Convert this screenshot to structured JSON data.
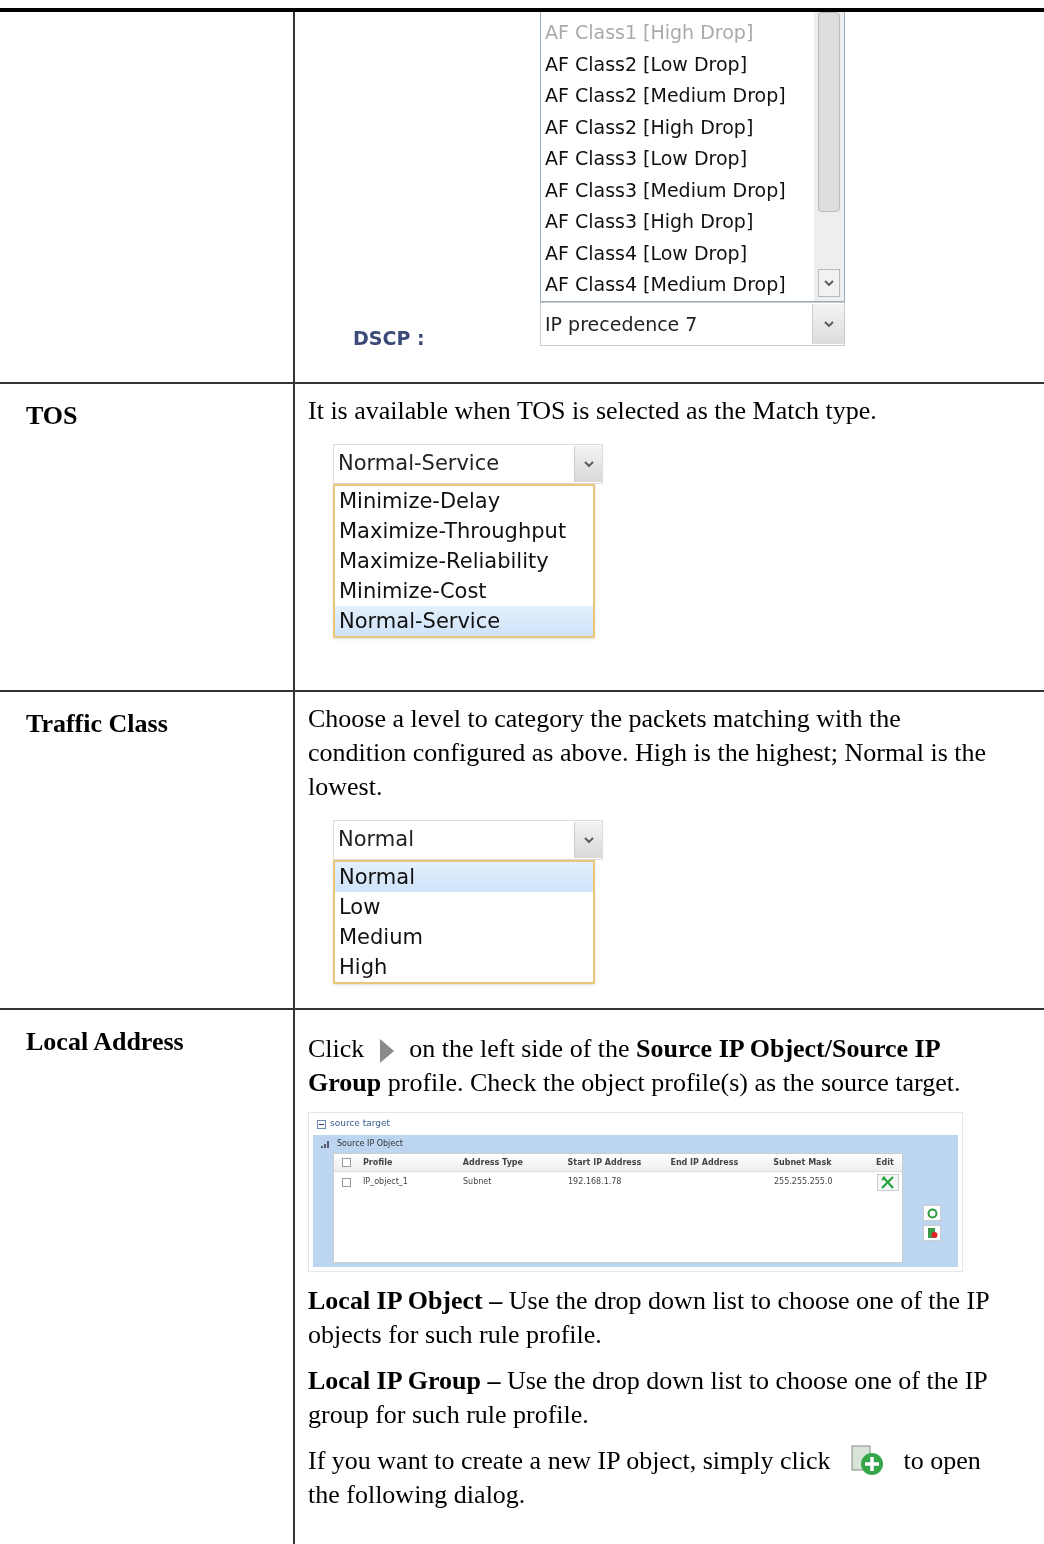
{
  "dscp_row": {
    "list_items": [
      {
        "label": "AF Class1 [High Drop]",
        "faded": true
      },
      {
        "label": "AF Class2 [Low Drop]",
        "faded": false
      },
      {
        "label": "AF Class2 [Medium Drop]",
        "faded": false
      },
      {
        "label": "AF Class2 [High Drop]",
        "faded": false
      },
      {
        "label": "AF Class3 [Low Drop]",
        "faded": false
      },
      {
        "label": "AF Class3 [Medium Drop]",
        "faded": false
      },
      {
        "label": "AF Class3 [High Drop]",
        "faded": false
      },
      {
        "label": "AF Class4 [Low Drop]",
        "faded": false
      },
      {
        "label": "AF Class4 [Medium Drop]",
        "faded": false
      }
    ],
    "label": "DSCP :",
    "value": "IP precedence 7"
  },
  "rows": [
    {
      "kind": "dropdown",
      "label": "TOS",
      "description": "It is available when TOS is selected as the Match type.",
      "dropdown": {
        "value": "Normal-Service",
        "options": [
          {
            "label": "Minimize-Delay",
            "selected": false
          },
          {
            "label": "Maximize-Throughput",
            "selected": false
          },
          {
            "label": "Maximize-Reliability",
            "selected": false
          },
          {
            "label": "Minimize-Cost",
            "selected": false
          },
          {
            "label": "Normal-Service",
            "selected": true
          }
        ]
      }
    },
    {
      "kind": "dropdown",
      "label": "Traffic Class",
      "description": "Choose a level to category the packets matching with the condition configured as above. High is the highest; Normal is the lowest.",
      "dropdown": {
        "value": "Normal",
        "options": [
          {
            "label": "Normal",
            "selected": true
          },
          {
            "label": "Low",
            "selected": false
          },
          {
            "label": "Medium",
            "selected": false
          },
          {
            "label": "High",
            "selected": false
          }
        ]
      }
    },
    {
      "kind": "local",
      "label": "Local Address",
      "intro_before": "Click",
      "intro_after": "on the left side of the **Source IP Object/Source IP Group** profile. Check the object profile(s) as the source target.",
      "panel": {
        "title": "source target",
        "header_checked": false,
        "section": "Source IP Object",
        "columns": [
          "Profile",
          "Address Type",
          "Start IP Address",
          "End IP Address",
          "Subnet Mask",
          "Edit"
        ],
        "rows": [
          {
            "checked": false,
            "cells": [
              "IP_object_1",
              "Subnet",
              "192.168.1.78",
              "",
              "255.255.255.0"
            ]
          }
        ]
      },
      "paragraphs": [
        "**Local IP Object –** Use the drop down list to choose one of the IP objects for such rule profile.",
        "**Local IP Group –** Use the drop down list to choose one of the IP group for such rule profile."
      ],
      "outro_before": "If you want to create a new IP object, simply click",
      "outro_after": "to open the following dialog."
    }
  ]
}
